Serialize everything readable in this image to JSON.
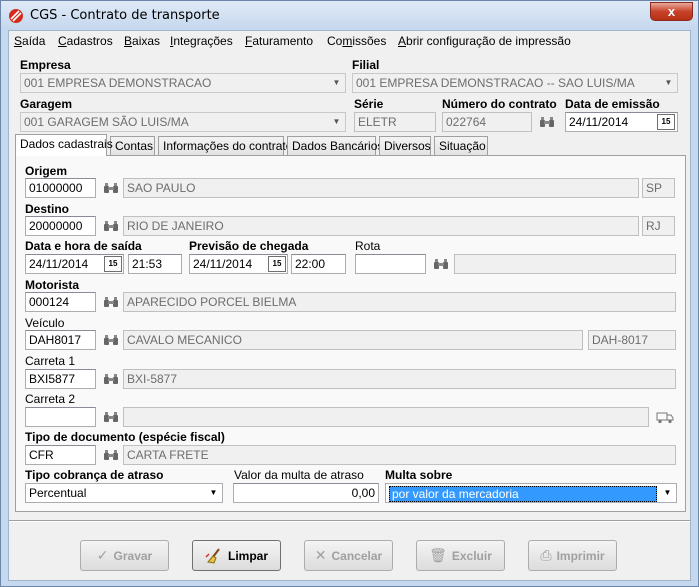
{
  "window": {
    "title": "CGS - Contrato de transporte",
    "close_label": "x"
  },
  "menu": [
    {
      "label": "Saída",
      "u": "S",
      "rest": "aída"
    },
    {
      "label": "Cadastros",
      "u": "C",
      "rest": "adastros"
    },
    {
      "label": "Baixas",
      "u": "B",
      "rest": "aixas"
    },
    {
      "label": "Integrações",
      "u": "I",
      "rest": "ntegrações"
    },
    {
      "label": "Faturamento",
      "u": "F",
      "rest": "aturamento"
    },
    {
      "label": "Comissões",
      "pre": "Co",
      "u": "m",
      "rest": "issões"
    },
    {
      "label": "Abrir configuração de impressão",
      "u": "A",
      "rest": "brir configuração de impressão"
    }
  ],
  "header": {
    "empresa_label": "Empresa",
    "empresa_value": "001 EMPRESA DEMONSTRACAO",
    "filial_label": "Filial",
    "filial_value": "001 EMPRESA DEMONSTRACAO -- SAO LUIS/MA",
    "garagem_label": "Garagem",
    "garagem_value": "001 GARAGEM SÃO LUIS/MA",
    "serie_label": "Série",
    "serie_value": "ELETR",
    "numero_label": "Número do contrato",
    "numero_value": "022764",
    "emissao_label": "Data de emissão",
    "emissao_value": "24/11/2014"
  },
  "tabs": [
    "Dados cadastrais",
    "Contas",
    "Informações do contrato",
    "Dados Bancários",
    "Diversos",
    "Situação"
  ],
  "form": {
    "origem_label": "Origem",
    "origem_code": "01000000",
    "origem_name": "SAO PAULO",
    "origem_uf": "SP",
    "destino_label": "Destino",
    "destino_code": "20000000",
    "destino_name": "RIO DE JANEIRO",
    "destino_uf": "RJ",
    "saida_label": "Data e hora de saída",
    "saida_date": "24/11/2014",
    "saida_time": "21:53",
    "chegada_label": "Previsão de chegada",
    "chegada_date": "24/11/2014",
    "chegada_time": "22:00",
    "rota_label": "Rota",
    "rota_value": "",
    "rota_desc": "",
    "motorista_label": "Motorista",
    "motorista_code": "000124",
    "motorista_name": "APARECIDO PORCEL BIELMA",
    "veiculo_label": "Veículo",
    "veiculo_code": "DAH8017",
    "veiculo_name": "CAVALO MECANICO",
    "veiculo_plate": "DAH-8017",
    "carreta1_label": "Carreta 1",
    "carreta1_code": "BXI5877",
    "carreta1_name": "BXI-5877",
    "carreta2_label": "Carreta 2",
    "carreta2_code": "",
    "carreta2_name": "",
    "tipodoc_label": "Tipo de documento (espécie fiscal)",
    "tipodoc_code": "CFR",
    "tipodoc_name": "CARTA FRETE",
    "cobranca_label": "Tipo cobrança de atraso",
    "cobranca_value": "Percentual",
    "multa_label": "Valor da multa de atraso",
    "multa_value": "0,00",
    "multa_sobre_label": "Multa sobre",
    "multa_sobre_value": "por valor da mercadoria"
  },
  "buttons": {
    "gravar": "Gravar",
    "limpar": "Limpar",
    "cancelar": "Cancelar",
    "excluir": "Excluir",
    "imprimir": "Imprimir"
  },
  "calendar_icon_text": "15"
}
